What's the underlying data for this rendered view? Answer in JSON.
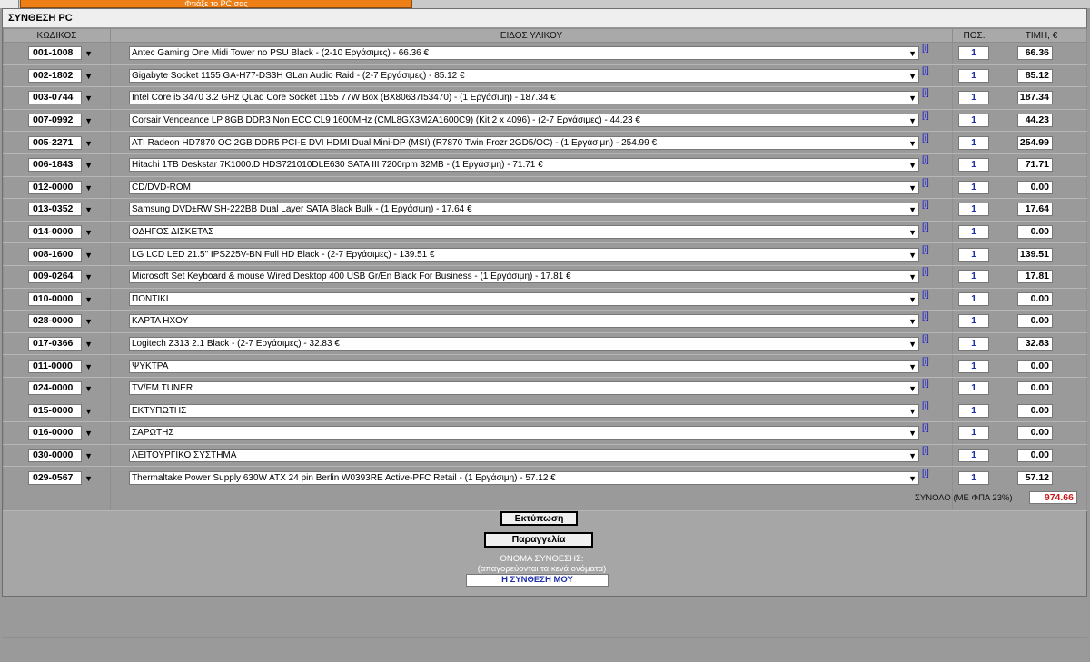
{
  "top_tab_label": "Φτιάξε το PC σας",
  "panel_title": "ΣΥΝΘΕΣΗ PC",
  "columns": {
    "code": "ΚΩΔΙΚΟΣ",
    "item": "ΕΙΔΟΣ ΥΛΙΚΟΥ",
    "qty": "ΠΟΣ.",
    "price": "ΤΙΜΗ, €"
  },
  "info_label": "[i]",
  "rows": [
    {
      "code": "001-1008",
      "desc": "Antec Gaming One Midi Tower no PSU Black - (2-10 Εργάσιμες) - 66.36 €",
      "qty": "1",
      "price": "66.36"
    },
    {
      "code": "002-1802",
      "desc": "Gigabyte Socket 1155 GA-H77-DS3H GLan Audio Raid - (2-7 Εργάσιμες) - 85.12 €",
      "qty": "1",
      "price": "85.12"
    },
    {
      "code": "003-0744",
      "desc": "Intel Core i5 3470 3.2 GHz Quad Core Socket 1155 77W Box (BX80637I53470) - (1 Εργάσιμη) - 187.34 €",
      "qty": "1",
      "price": "187.34"
    },
    {
      "code": "007-0992",
      "desc": "Corsair Vengeance LP 8GB DDR3 Non ECC CL9 1600MHz (CML8GX3M2A1600C9) (Kit 2 x 4096) - (2-7 Εργάσιμες) - 44.23 €",
      "qty": "1",
      "price": "44.23"
    },
    {
      "code": "005-2271",
      "desc": "ATI Radeon HD7870 OC 2GB DDR5 PCI-E DVI HDMI Dual Mini-DP (MSI) (R7870 Twin Frozr 2GD5/OC) - (1 Εργάσιμη) - 254.99 €",
      "qty": "1",
      "price": "254.99"
    },
    {
      "code": "006-1843",
      "desc": "Hitachi 1TB Deskstar 7K1000.D HDS721010DLE630 SATA III 7200rpm 32MB - (1 Εργάσιμη) - 71.71 €",
      "qty": "1",
      "price": "71.71"
    },
    {
      "code": "012-0000",
      "desc": "CD/DVD-ROM",
      "qty": "1",
      "price": "0.00"
    },
    {
      "code": "013-0352",
      "desc": "Samsung DVD±RW SH-222BB Dual Layer SATA Black Bulk - (1 Εργάσιμη) - 17.64 €",
      "qty": "1",
      "price": "17.64"
    },
    {
      "code": "014-0000",
      "desc": "ΟΔΗΓΟΣ ΔΙΣΚΕΤΑΣ",
      "qty": "1",
      "price": "0.00"
    },
    {
      "code": "008-1600",
      "desc": "LG LCD LED 21.5\" IPS225V-BN Full HD Black - (2-7 Εργάσιμες) - 139.51 €",
      "qty": "1",
      "price": "139.51"
    },
    {
      "code": "009-0264",
      "desc": "Microsoft Set Keyboard & mouse Wired Desktop 400 USB Gr/En Black For Business - (1 Εργάσιμη) - 17.81 €",
      "qty": "1",
      "price": "17.81"
    },
    {
      "code": "010-0000",
      "desc": "ΠΟΝΤΙΚΙ",
      "qty": "1",
      "price": "0.00"
    },
    {
      "code": "028-0000",
      "desc": "ΚΑΡΤΑ ΗΧΟΥ",
      "qty": "1",
      "price": "0.00"
    },
    {
      "code": "017-0366",
      "desc": "Logitech Z313 2.1 Black - (2-7 Εργάσιμες) - 32.83 €",
      "qty": "1",
      "price": "32.83"
    },
    {
      "code": "011-0000",
      "desc": "ΨΥΚΤΡΑ",
      "qty": "1",
      "price": "0.00"
    },
    {
      "code": "024-0000",
      "desc": "TV/FM TUNER",
      "qty": "1",
      "price": "0.00"
    },
    {
      "code": "015-0000",
      "desc": "ΕΚΤΥΠΩΤΗΣ",
      "qty": "1",
      "price": "0.00"
    },
    {
      "code": "016-0000",
      "desc": "ΣΑΡΩΤΗΣ",
      "qty": "1",
      "price": "0.00"
    },
    {
      "code": "030-0000",
      "desc": "ΛΕΙΤΟΥΡΓΙΚΟ ΣΥΣΤΗΜΑ",
      "qty": "1",
      "price": "0.00"
    },
    {
      "code": "029-0567",
      "desc": "Thermaltake Power Supply 630W ATX 24 pin Berlin W0393RE Active-PFC Retail - (1 Εργάσιμη) - 57.12 €",
      "qty": "1",
      "price": "57.12"
    }
  ],
  "total": {
    "label": "ΣΥΝΟΛΟ (ΜΕ ΦΠΑ 23%)",
    "value": "974.66"
  },
  "buttons": {
    "print": "Εκτύπωση",
    "order": "Παραγγελία"
  },
  "name_section": {
    "title": "ΟΝΟΜΑ ΣΥΝΘΕΣΗΣ:",
    "hint": "(απαγορεύονται τα κενά ονόματα)",
    "value": "Η ΣΥΝΘΕΣΗ ΜΟΥ"
  }
}
